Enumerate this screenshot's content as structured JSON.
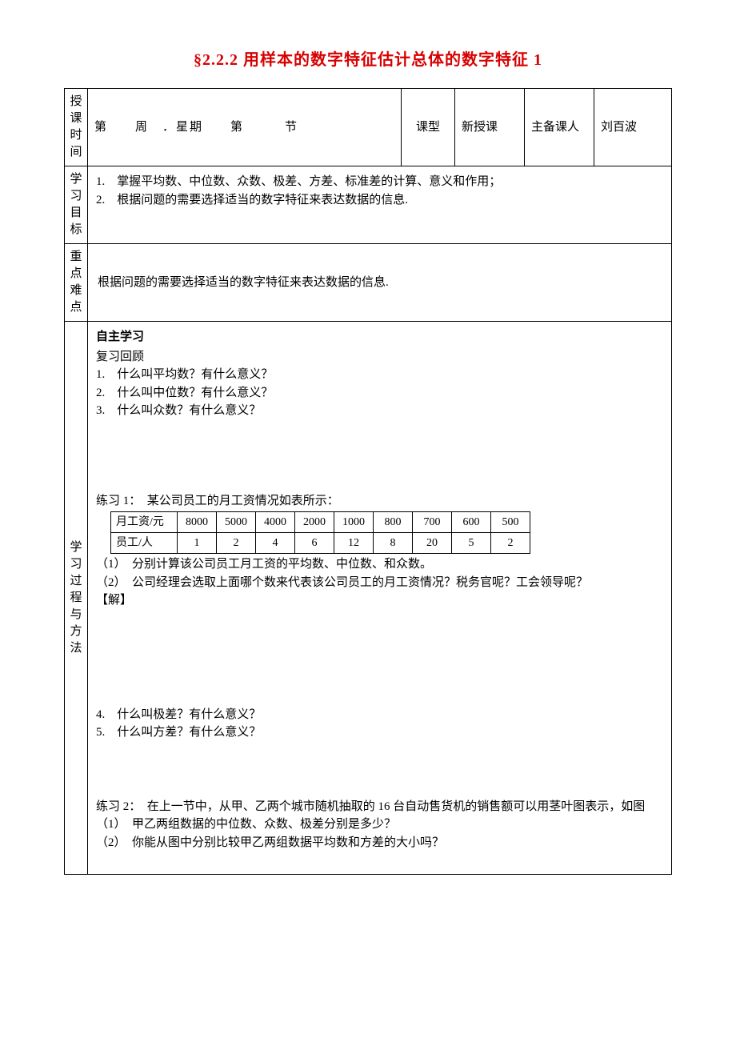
{
  "title": "§2.2.2 用样本的数字特征估计总体的数字特征 1",
  "row1": {
    "label": "授课时间",
    "schedule": "第　　周　．星期　　第　　　节",
    "ktype_label": "课型",
    "ktype_value": "新授课",
    "zb_label": "主备课人",
    "zb_value": "刘百波"
  },
  "objectives": {
    "label": "学习目标",
    "items": [
      "1.　掌握平均数、中位数、众数、极差、方差、标准差的计算、意义和作用；",
      "2.　根据问题的需要选择适当的数字特征来表达数据的信息."
    ]
  },
  "keypoints": {
    "label": "重点难点",
    "text": "根据问题的需要选择适当的数字特征来表达数据的信息."
  },
  "process": {
    "label": "学习过程与方法",
    "self_study_title": "自主学习",
    "review_title": "复习回顾",
    "review_items": [
      "1.　什么叫平均数？有什么意义？",
      "2.　什么叫中位数？有什么意义？",
      "3.　什么叫众数？有什么意义？"
    ],
    "ex1_title": "练习 1：　某公司员工的月工资情况如表所示：",
    "salary_table": {
      "row1_label": "月工资/元",
      "row1": [
        "8000",
        "5000",
        "4000",
        "2000",
        "1000",
        "800",
        "700",
        "600",
        "500"
      ],
      "row2_label": "员工/人",
      "row2": [
        "1",
        "2",
        "4",
        "6",
        "12",
        "8",
        "20",
        "5",
        "2"
      ]
    },
    "ex1_q1": "（1）　分别计算该公司员工月工资的平均数、中位数、和众数。",
    "ex1_q2": "（2）　公司经理会选取上面哪个数来代表该公司员工的月工资情况？税务官呢？工会领导呢？",
    "ex1_ans": "【解】",
    "review_items2": [
      "4.　什么叫极差？有什么意义？",
      "5.　什么叫方差？有什么意义？"
    ],
    "ex2_title": "练习 2：　在上一节中，从甲、乙两个城市随机抽取的 16 台自动售货机的销售额可以用茎叶图表示，如图",
    "ex2_q1": "（1）　甲乙两组数据的中位数、众数、极差分别是多少？",
    "ex2_q2": "（2）　你能从图中分别比较甲乙两组数据平均数和方差的大小吗？"
  }
}
